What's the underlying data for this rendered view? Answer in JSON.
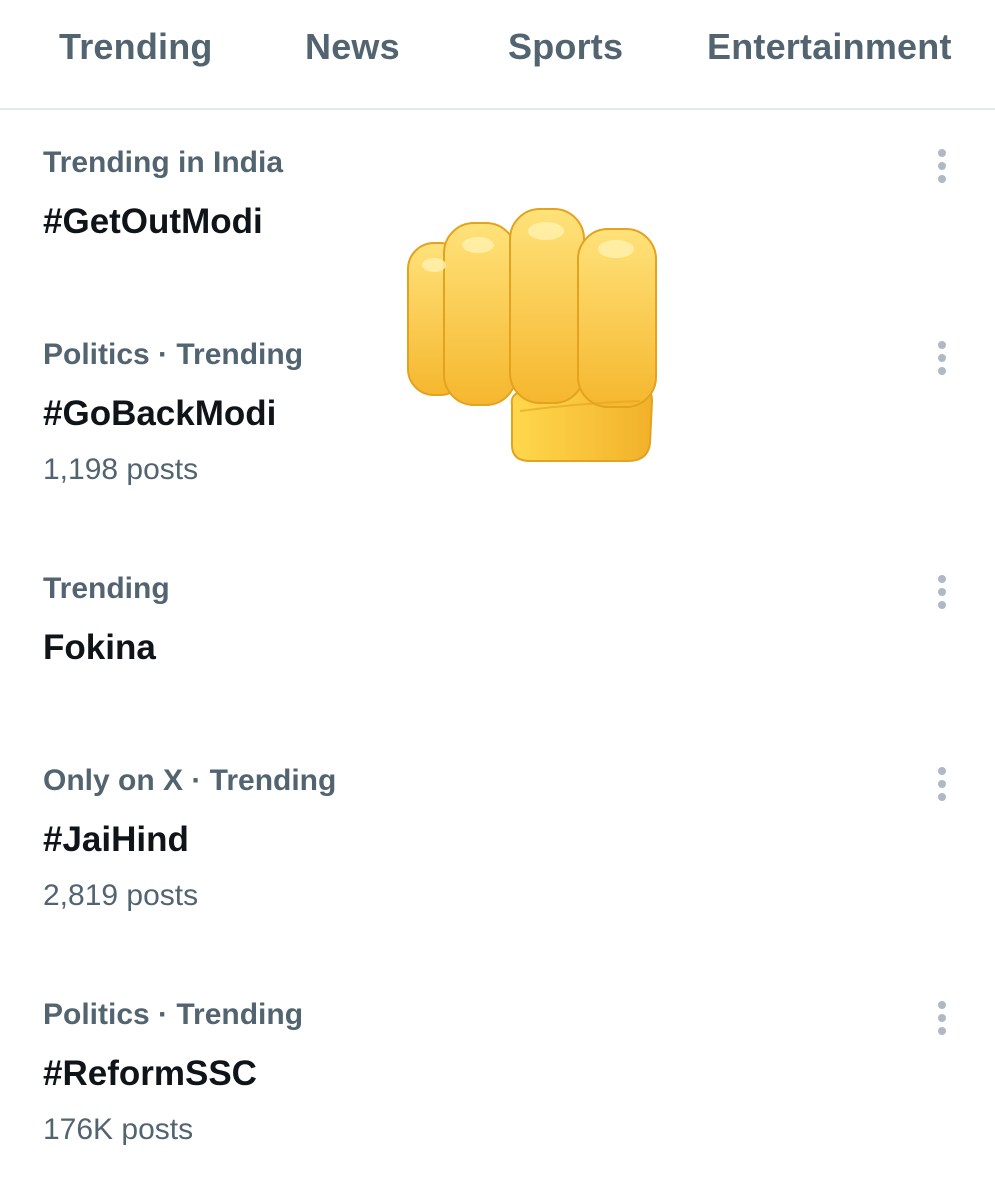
{
  "tabs": [
    {
      "label": "Trending"
    },
    {
      "label": "News"
    },
    {
      "label": "Sports"
    },
    {
      "label": "Entertainment"
    }
  ],
  "trends": [
    {
      "context": "Trending in India",
      "topic": "#GetOutModi",
      "posts": ""
    },
    {
      "context": "Politics · Trending",
      "topic": "#GoBackModi",
      "posts": "1,198 posts"
    },
    {
      "context": "Trending",
      "topic": "Fokina",
      "posts": ""
    },
    {
      "context": "Only on X · Trending",
      "topic": "#JaiHind",
      "posts": "2,819 posts"
    },
    {
      "context": "Politics · Trending",
      "topic": "#ReformSSC",
      "posts": "176K posts"
    }
  ],
  "icons": {
    "more": "more-options-icon",
    "overlay": "oncoming-fist-emoji"
  },
  "colors": {
    "primary_text": "#0f1419",
    "secondary_text": "#536471",
    "divider": "#e6e9ec",
    "fist_yellow": "#FFD43B"
  }
}
